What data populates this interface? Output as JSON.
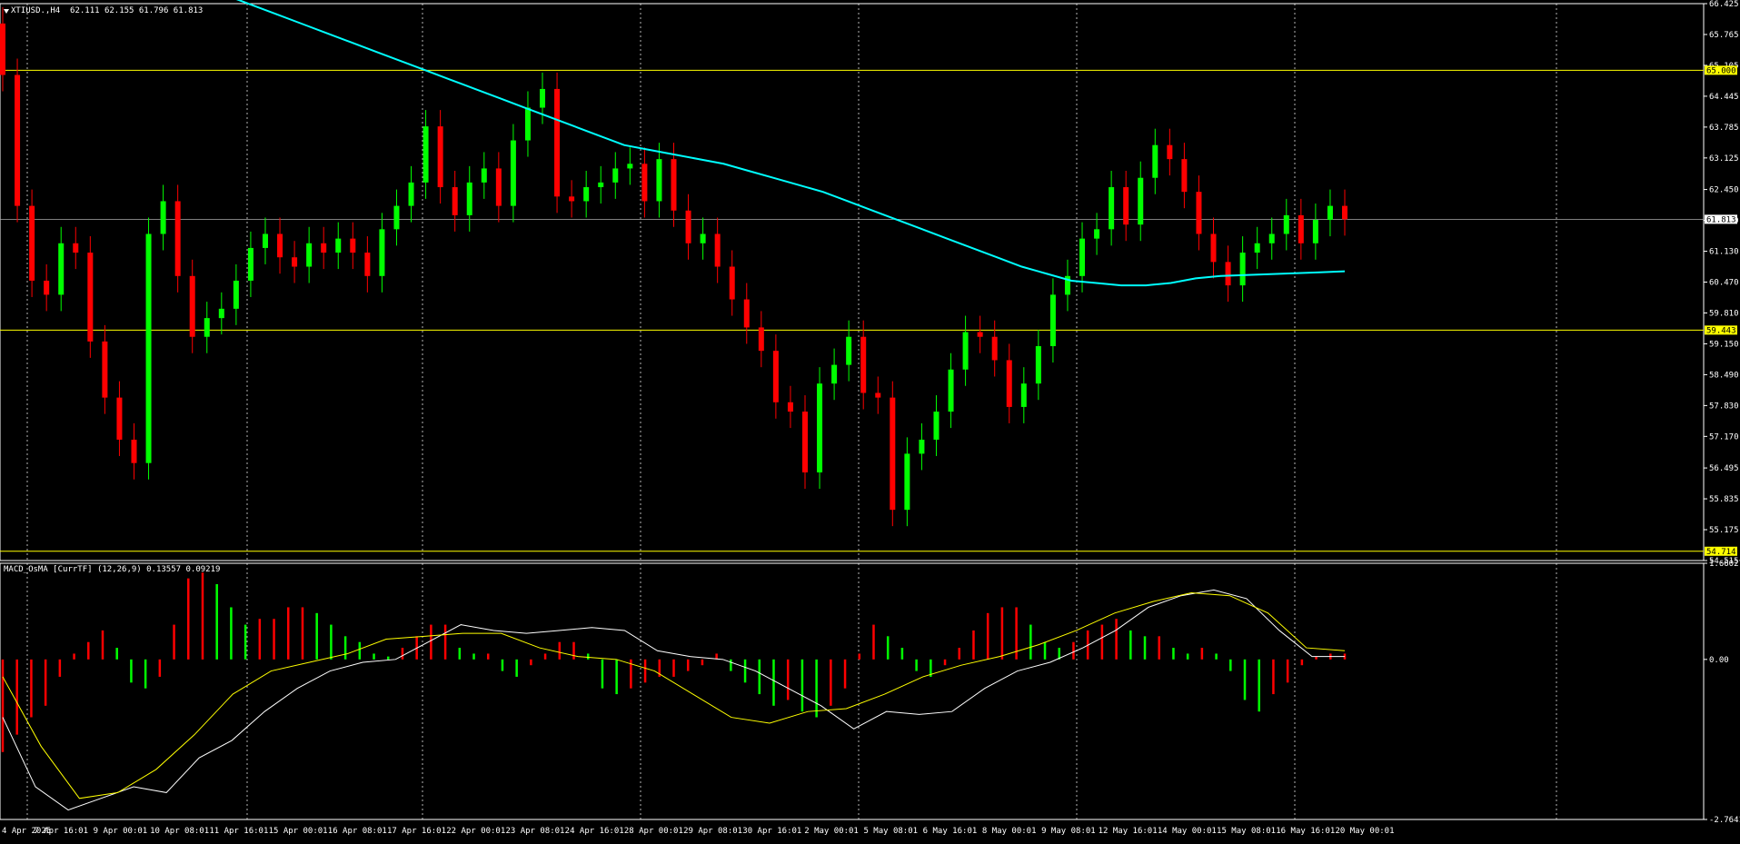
{
  "chart_data": [
    {
      "type": "candlestick",
      "symbol_label": "XTIUSD.,H4  62.111 62.155 61.796 61.813",
      "ylim": [
        54.515,
        66.425
      ],
      "y_ticks": [
        "66.425",
        "65.765",
        "65.105",
        "64.445",
        "63.785",
        "63.125",
        "62.450",
        "61.790",
        "61.130",
        "60.470",
        "59.810",
        "59.150",
        "58.490",
        "57.830",
        "57.170",
        "56.495",
        "55.835",
        "55.175",
        "54.515"
      ],
      "x_labels": [
        "4 Apr 2025",
        "7 Apr 16:01",
        "9 Apr 00:01",
        "10 Apr 08:01",
        "11 Apr 16:01",
        "15 Apr 00:01",
        "16 Apr 08:01",
        "17 Apr 16:01",
        "22 Apr 00:01",
        "23 Apr 08:01",
        "24 Apr 16:01",
        "28 Apr 00:01",
        "29 Apr 08:01",
        "30 Apr 16:01",
        "2 May 00:01",
        "5 May 08:01",
        "6 May 16:01",
        "8 May 00:01",
        "9 May 08:01",
        "12 May 16:01",
        "14 May 00:01",
        "15 May 08:01",
        "16 May 16:01",
        "20 May 00:01"
      ],
      "horizontal_levels": [
        {
          "value": 65.0,
          "label": "65.000",
          "color": "#ffff00"
        },
        {
          "value": 59.443,
          "label": "59.443",
          "color": "#ffff00"
        },
        {
          "value": 54.714,
          "label": "54.714",
          "color": "#ffff00"
        }
      ],
      "bid_line": {
        "value": 61.813,
        "label": "61.813",
        "color": "#a9a9a9"
      },
      "closes": [
        64.9,
        62.1,
        60.5,
        60.2,
        61.3,
        61.1,
        59.2,
        58.0,
        57.1,
        56.6,
        61.5,
        62.2,
        60.6,
        59.3,
        59.7,
        59.9,
        60.5,
        61.2,
        61.5,
        61.0,
        60.8,
        61.3,
        61.1,
        61.4,
        61.1,
        60.6,
        61.6,
        62.1,
        62.6,
        63.8,
        62.5,
        61.9,
        62.6,
        62.9,
        62.1,
        63.5,
        64.2,
        64.6,
        62.3,
        62.2,
        62.5,
        62.6,
        62.9,
        63.0,
        62.2,
        63.1,
        62.0,
        61.3,
        61.5,
        60.8,
        60.1,
        59.5,
        59.0,
        57.9,
        57.7,
        56.4,
        58.3,
        58.7,
        59.3,
        58.1,
        58.0,
        55.6,
        56.8,
        57.1,
        57.7,
        58.6,
        59.4,
        59.3,
        58.8,
        57.8,
        58.3,
        59.1,
        60.2,
        60.6,
        61.4,
        61.6,
        62.5,
        61.7,
        62.7,
        63.4,
        63.1,
        62.4,
        61.5,
        60.9,
        60.4,
        61.1,
        61.3,
        61.5,
        61.9,
        61.3,
        61.8,
        62.1,
        61.813
      ],
      "moving_average": [
        67.2,
        67.1,
        67.0,
        66.8,
        66.6,
        66.4,
        66.2,
        66.0,
        65.8,
        65.6,
        65.4,
        65.2,
        65.0,
        64.8,
        64.6,
        64.4,
        64.2,
        64.0,
        63.8,
        63.6,
        63.4,
        63.3,
        63.2,
        63.1,
        63.0,
        62.85,
        62.7,
        62.55,
        62.4,
        62.2,
        62.0,
        61.8,
        61.6,
        61.4,
        61.2,
        61.0,
        60.8,
        60.65,
        60.5,
        60.45,
        60.4,
        60.4,
        60.45,
        60.55,
        60.6,
        60.62,
        60.64,
        60.66,
        60.68,
        60.7
      ],
      "colors": {
        "bull": "#00ff00",
        "bear": "#ff0000",
        "ma": "#00ffff",
        "grid": "#ffffff"
      }
    },
    {
      "type": "histogram",
      "indicator_label": "MACD_OsMA [CurrTF] (12,26,9) 0.13557 0.09219",
      "ylim": [
        -2.76411,
        1.66027
      ],
      "y_ticks": [
        "1.66027",
        "0.00",
        "-2.76411"
      ],
      "histogram": [
        -1.6,
        -1.3,
        -1.0,
        -0.8,
        -0.3,
        0.1,
        0.3,
        0.5,
        0.2,
        -0.4,
        -0.5,
        -0.3,
        0.6,
        1.4,
        1.5,
        1.3,
        0.9,
        0.6,
        0.7,
        0.7,
        0.9,
        0.9,
        0.8,
        0.6,
        0.4,
        0.3,
        0.1,
        0.05,
        0.2,
        0.4,
        0.6,
        0.6,
        0.2,
        0.1,
        0.1,
        -0.2,
        -0.3,
        -0.1,
        0.1,
        0.3,
        0.3,
        0.1,
        -0.5,
        -0.6,
        -0.5,
        -0.4,
        -0.3,
        -0.3,
        -0.2,
        -0.1,
        0.1,
        -0.2,
        -0.4,
        -0.6,
        -0.8,
        -0.7,
        -0.9,
        -1.0,
        -0.8,
        -0.5,
        0.1,
        0.6,
        0.4,
        0.2,
        -0.2,
        -0.3,
        -0.1,
        0.2,
        0.5,
        0.8,
        0.9,
        0.9,
        0.6,
        0.3,
        0.2,
        0.3,
        0.5,
        0.6,
        0.7,
        0.5,
        0.4,
        0.4,
        0.2,
        0.1,
        0.2,
        0.1,
        -0.2,
        -0.7,
        -0.9,
        -0.6,
        -0.4,
        -0.1,
        0.05,
        0.1,
        0.1
      ],
      "macd_line": [
        -1.0,
        -2.2,
        -2.6,
        -2.4,
        -2.2,
        -2.3,
        -1.7,
        -1.4,
        -0.9,
        -0.5,
        -0.2,
        -0.05,
        0.0,
        0.3,
        0.6,
        0.5,
        0.45,
        0.5,
        0.55,
        0.5,
        0.15,
        0.05,
        0.0,
        -0.2,
        -0.5,
        -0.8,
        -1.2,
        -0.9,
        -0.95,
        -0.9,
        -0.5,
        -0.2,
        -0.05,
        0.2,
        0.5,
        0.9,
        1.1,
        1.2,
        1.05,
        0.5,
        0.05,
        0.05
      ],
      "signal_line": [
        -0.3,
        -1.5,
        -2.4,
        -2.3,
        -1.9,
        -1.3,
        -0.6,
        -0.2,
        -0.05,
        0.1,
        0.35,
        0.4,
        0.45,
        0.45,
        0.2,
        0.05,
        0.0,
        -0.2,
        -0.6,
        -1.0,
        -1.1,
        -0.9,
        -0.85,
        -0.6,
        -0.3,
        -0.1,
        0.05,
        0.25,
        0.5,
        0.8,
        1.0,
        1.15,
        1.1,
        0.8,
        0.2,
        0.15
      ],
      "colors": {
        "up": "#ff0000",
        "down": "#00ff00",
        "macd": "#ffffff",
        "signal": "#ffff00"
      }
    }
  ]
}
